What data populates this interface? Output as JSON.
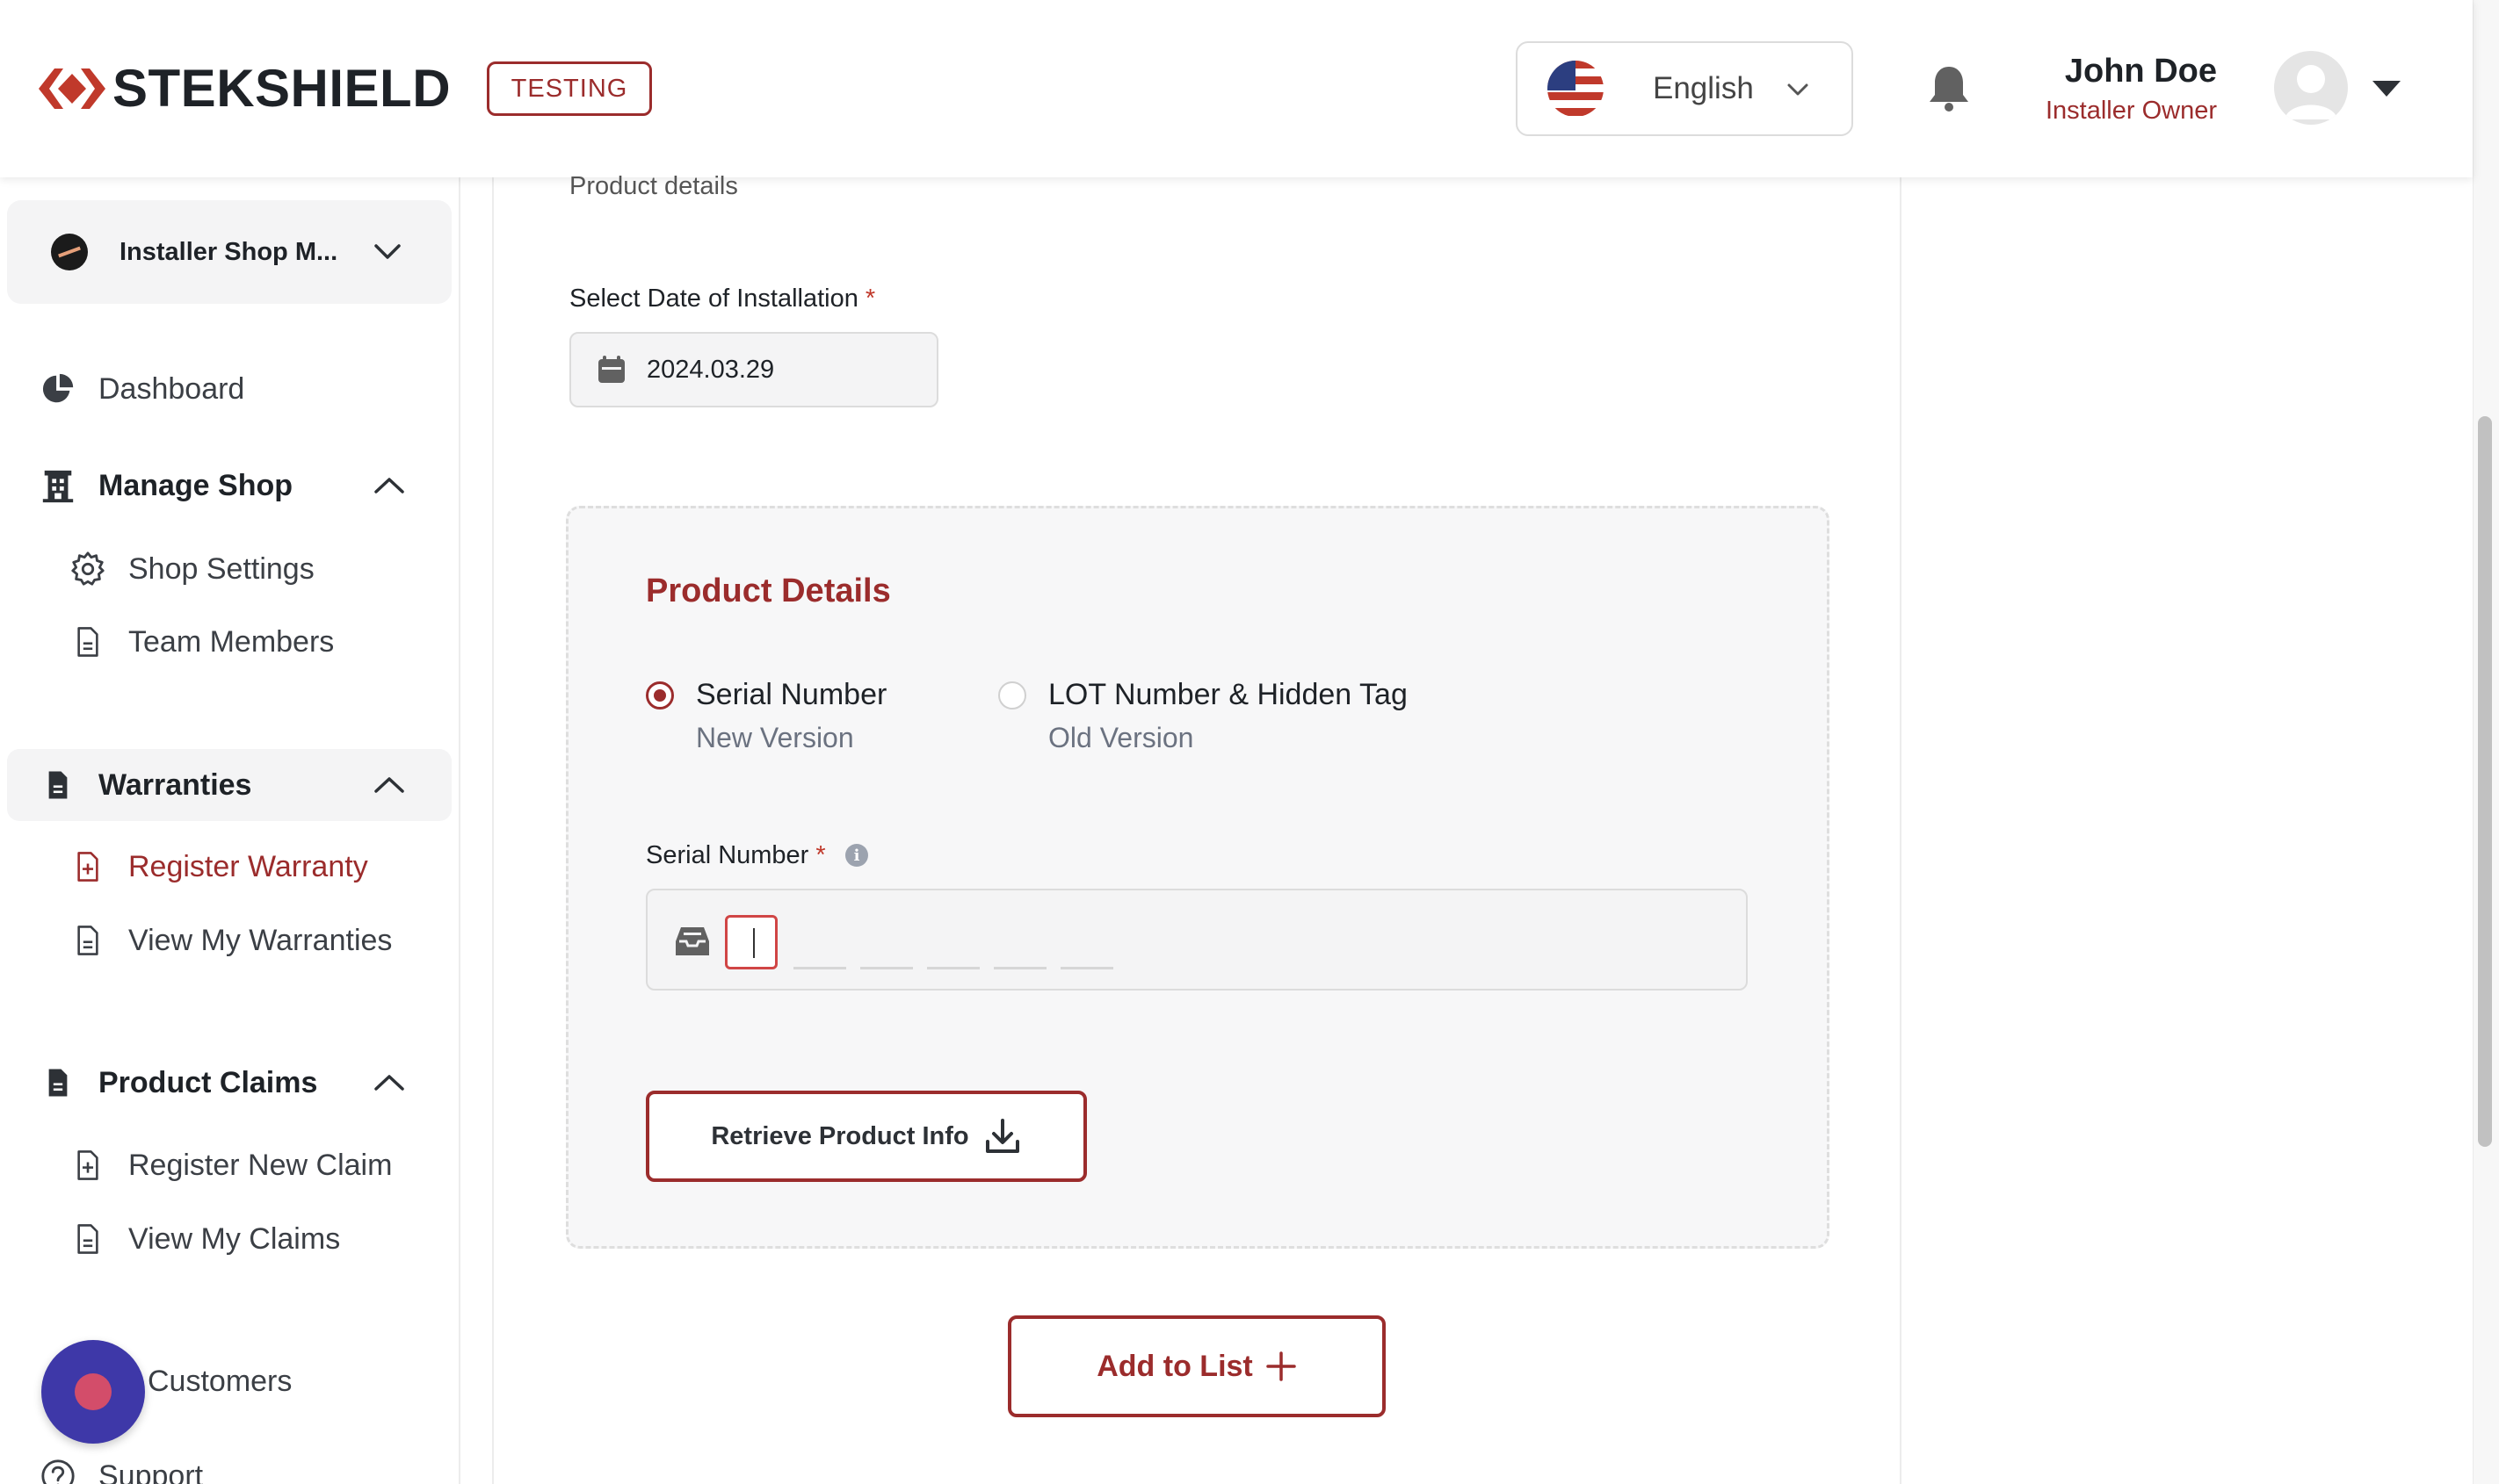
{
  "header": {
    "logo_text": "STEKSHIELD",
    "env_badge": "TESTING",
    "language": "English",
    "user_name": "John Doe",
    "user_role": "Installer Owner"
  },
  "sidebar": {
    "shop_name": "Installer Shop M...",
    "items": {
      "dashboard": "Dashboard",
      "manage_shop": "Manage Shop",
      "shop_settings": "Shop Settings",
      "team_members": "Team Members",
      "warranties": "Warranties",
      "register_warranty": "Register Warranty",
      "view_my_warranties": "View My Warranties",
      "product_claims": "Product Claims",
      "register_new_claim": "Register New Claim",
      "view_my_claims": "View My Claims",
      "customers": "Customers",
      "support": "Support"
    },
    "active_item": "Register Warranty"
  },
  "main": {
    "breadcrumb": "Product details",
    "date_label": "Select Date of Installation",
    "required_mark": "*",
    "date_value": "2024.03.29",
    "section_title": "Product Details",
    "options": [
      {
        "title": "Serial Number",
        "subtitle": "New Version",
        "selected": true
      },
      {
        "title": "LOT Number & Hidden Tag",
        "subtitle": "Old Version",
        "selected": false
      }
    ],
    "serial_label": "Serial Number",
    "info_glyph": "i",
    "retrieve_button": "Retrieve Product Info",
    "add_button": "Add to List"
  },
  "colors": {
    "brand": "#9b2c2c",
    "fab": "#3e38a8",
    "panel_bg": "#f7f7f8"
  }
}
